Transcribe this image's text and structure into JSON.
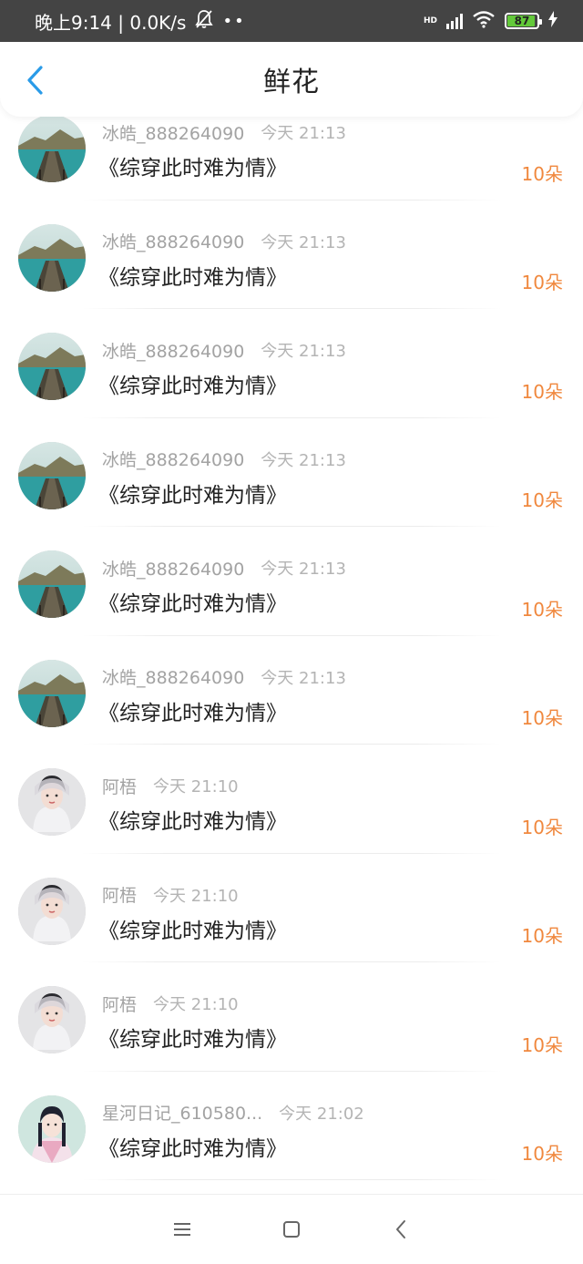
{
  "status_bar": {
    "time_net": "晚上9:14 | 0.0K/s",
    "dots": "••",
    "hd": "HD",
    "battery": "87"
  },
  "header": {
    "title": "鲜花"
  },
  "colors": {
    "accent": "#2a9be8",
    "flower_count": "#f0883e"
  },
  "items": [
    {
      "user": "冰皓_888264090",
      "time": "今天 21:13",
      "book": "《综穿此时难为情》",
      "flowers": "10朵",
      "avatar": "pier-avatar"
    },
    {
      "user": "冰皓_888264090",
      "time": "今天 21:13",
      "book": "《综穿此时难为情》",
      "flowers": "10朵",
      "avatar": "pier-avatar"
    },
    {
      "user": "冰皓_888264090",
      "time": "今天 21:13",
      "book": "《综穿此时难为情》",
      "flowers": "10朵",
      "avatar": "pier-avatar"
    },
    {
      "user": "冰皓_888264090",
      "time": "今天 21:13",
      "book": "《综穿此时难为情》",
      "flowers": "10朵",
      "avatar": "pier-avatar"
    },
    {
      "user": "冰皓_888264090",
      "time": "今天 21:13",
      "book": "《综穿此时难为情》",
      "flowers": "10朵",
      "avatar": "pier-avatar"
    },
    {
      "user": "冰皓_888264090",
      "time": "今天 21:13",
      "book": "《综穿此时难为情》",
      "flowers": "10朵",
      "avatar": "pier-avatar"
    },
    {
      "user": "阿梧",
      "time": "今天 21:10",
      "book": "《综穿此时难为情》",
      "flowers": "10朵",
      "avatar": "lady-avatar"
    },
    {
      "user": "阿梧",
      "time": "今天 21:10",
      "book": "《综穿此时难为情》",
      "flowers": "10朵",
      "avatar": "lady-avatar"
    },
    {
      "user": "阿梧",
      "time": "今天 21:10",
      "book": "《综穿此时难为情》",
      "flowers": "10朵",
      "avatar": "lady-avatar"
    },
    {
      "user": "星河日记_610580...",
      "time": "今天 21:02",
      "book": "《综穿此时难为情》",
      "flowers": "10朵",
      "avatar": "hanfu-avatar"
    }
  ],
  "nav": {
    "menu": "menu-icon",
    "home": "home-icon",
    "back": "back-icon"
  }
}
